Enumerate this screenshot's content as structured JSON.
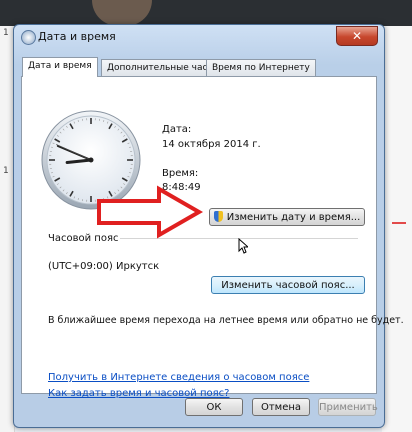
{
  "window": {
    "title": "Дата и время",
    "close_label": "✕"
  },
  "tabs": [
    {
      "label": "Дата и время",
      "active": true
    },
    {
      "label": "Дополнительные часы",
      "active": false
    },
    {
      "label": "Время по Интернету",
      "active": false
    }
  ],
  "clock": {
    "hour": 8,
    "minute": 48,
    "second": 49
  },
  "date": {
    "label": "Дата:",
    "value": "14 октября 2014 г."
  },
  "time": {
    "label": "Время:",
    "value": "8:48:49"
  },
  "change_datetime_button": "Изменить дату и время...",
  "timezone": {
    "section_label": "Часовой пояс",
    "value": "(UTC+09:00) Иркутск",
    "change_button": "Изменить часовой пояс..."
  },
  "dst_note": "В ближайшее время перехода на летнее время или обратно не будет.",
  "links": {
    "online_info": "Получить в Интернете сведения о часовом поясе",
    "how_to": "Как задать время и часовой пояс?"
  },
  "footer": {
    "ok": "ОК",
    "cancel": "Отмена",
    "apply": "Применить"
  },
  "background": {
    "left_numbers": [
      "1",
      "1"
    ]
  },
  "colors": {
    "annotation_arrow": "#e02020",
    "link": "#0a4ec4"
  }
}
